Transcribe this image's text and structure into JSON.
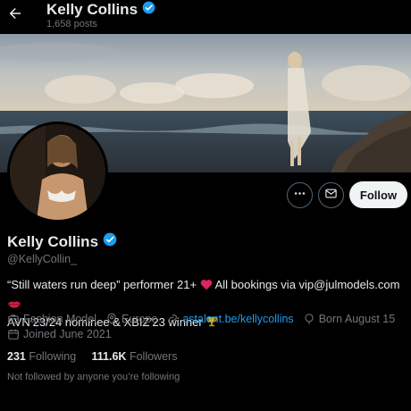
{
  "header": {
    "name": "Kelly Collins",
    "posts": "1,658 posts"
  },
  "actions": {
    "follow_label": "Follow"
  },
  "profile": {
    "name": "Kelly Collins",
    "handle": "@KellyCollin_",
    "bio_line1_a": "“Still waters run deep” performer 21+",
    "bio_line1_b": "All bookings via vip@julmodels.com",
    "bio_line2": "AVN’23/24 nominee & XBIZ’23 winner",
    "category": "Fashion Model",
    "location": "Europe",
    "website": "astalent.be/kellycollins",
    "birthday": "Born August 15",
    "joined": "Joined June 2021",
    "following_count": "231",
    "following_label": "Following",
    "followers_count": "111.6K",
    "followers_label": "Followers",
    "followed_by_text": "Not followed by anyone you’re following"
  },
  "colors": {
    "accent": "#1d9bf0",
    "background": "#000000",
    "muted": "#71767b"
  },
  "icons": [
    "back-arrow-icon",
    "verified-badge-icon",
    "more-icon",
    "message-icon",
    "briefcase-icon",
    "location-icon",
    "link-icon",
    "birthday-icon",
    "calendar-icon",
    "heart-emoji-icon",
    "lips-emoji-icon",
    "trophy-emoji-icon"
  ]
}
